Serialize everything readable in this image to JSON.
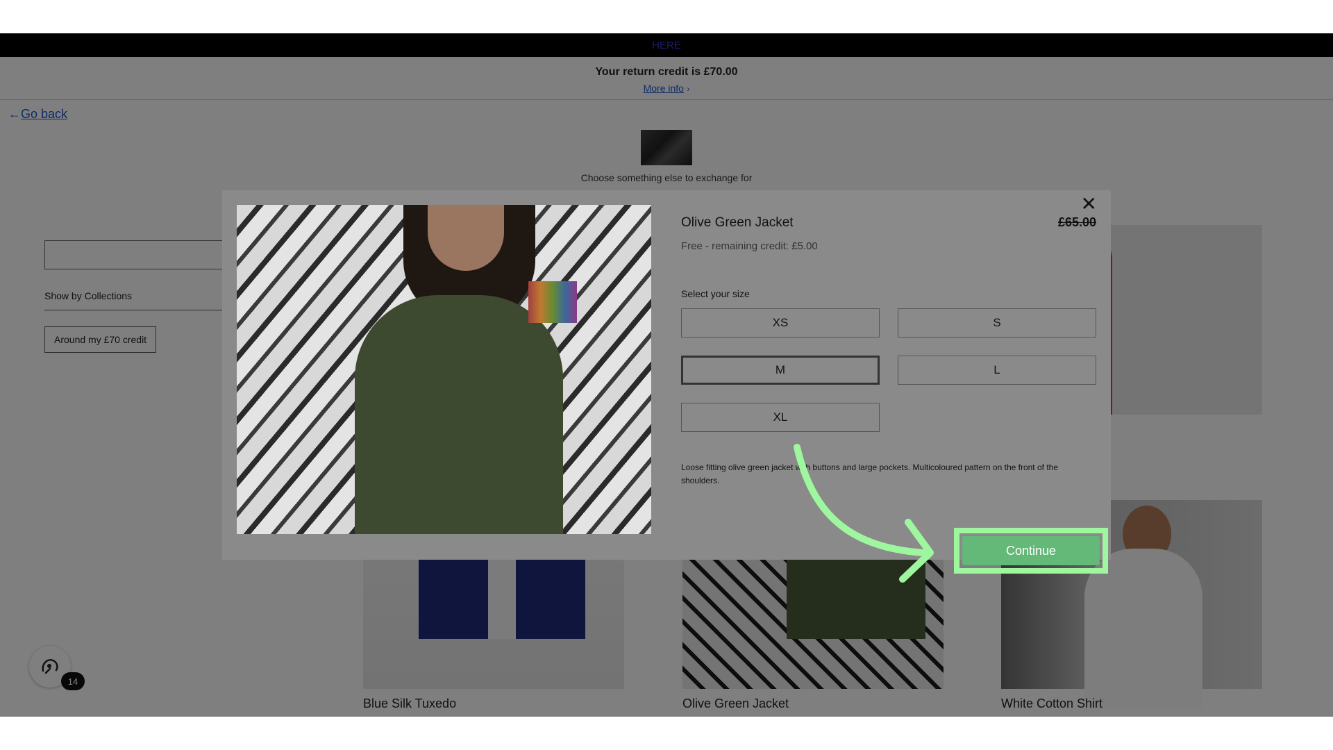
{
  "topbar": {
    "text": "HERE"
  },
  "credit": {
    "title": "Your return credit is £70.00",
    "link": "More info",
    "link_chevron": "›"
  },
  "nav": {
    "go_back": "Go back",
    "back_arrow": "←"
  },
  "main": {
    "choose_text": "Choose something else to exchange for"
  },
  "filters": {
    "show_by": "Show by Collections",
    "around_credit": "Around my £70 credit"
  },
  "products": [
    {
      "name": "Blue Silk Tuxedo"
    },
    {
      "name": "Olive Green Jacket"
    },
    {
      "name": "White Cotton Shirt"
    }
  ],
  "chat": {
    "badge": "14",
    "icon": "chat-assistant-icon"
  },
  "modal": {
    "title": "Olive Green Jacket",
    "price": "£65.00",
    "free_text": "Free - remaining credit: £5.00",
    "close": "✕",
    "size_label": "Select your size",
    "sizes": [
      "XS",
      "S",
      "M",
      "L",
      "XL"
    ],
    "selected_size": "M",
    "description": "Loose fitting olive green jacket with buttons and large pockets. Multicoloured pattern on the front of the shoulders.",
    "continue": "Continue"
  },
  "colors": {
    "highlight": "#9ef79e",
    "continue_bg": "#64b878",
    "link": "#1a56c9"
  }
}
